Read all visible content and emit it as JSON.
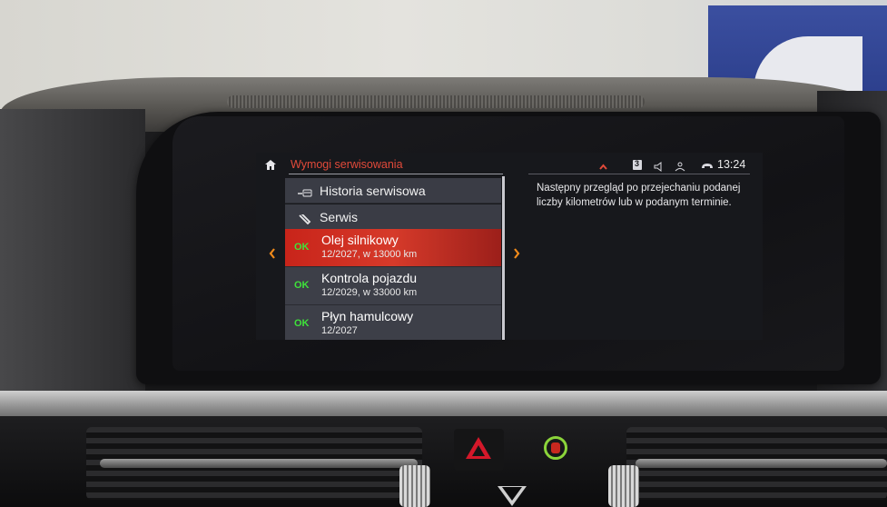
{
  "header": {
    "title": "Wymogi serwisowania",
    "time": "13:24",
    "status_icons": [
      "chevron-up-icon",
      "badge-icon",
      "speaker-icon",
      "people-icon",
      "phone-icon"
    ]
  },
  "menu": [
    {
      "label": "Historia serwisowa",
      "icon": "car-history-icon"
    },
    {
      "label": "Serwis",
      "icon": "wrench-icon"
    }
  ],
  "items": [
    {
      "status": "OK",
      "title": "Olej silnikowy",
      "subtitle": "12/2027, w 13000 km",
      "selected": true
    },
    {
      "status": "OK",
      "title": "Kontrola pojazdu",
      "subtitle": "12/2029, w 33000 km",
      "selected": false
    },
    {
      "status": "OK",
      "title": "Płyn hamulcowy",
      "subtitle": "12/2027",
      "selected": false
    }
  ],
  "description": "Następny przegląd po przejechaniu podanej liczby kilometrów lub w podanym terminie.",
  "colors": {
    "accent": "#d63a2a",
    "ok_green": "#3ee23a",
    "title_red": "#e24a3a"
  }
}
